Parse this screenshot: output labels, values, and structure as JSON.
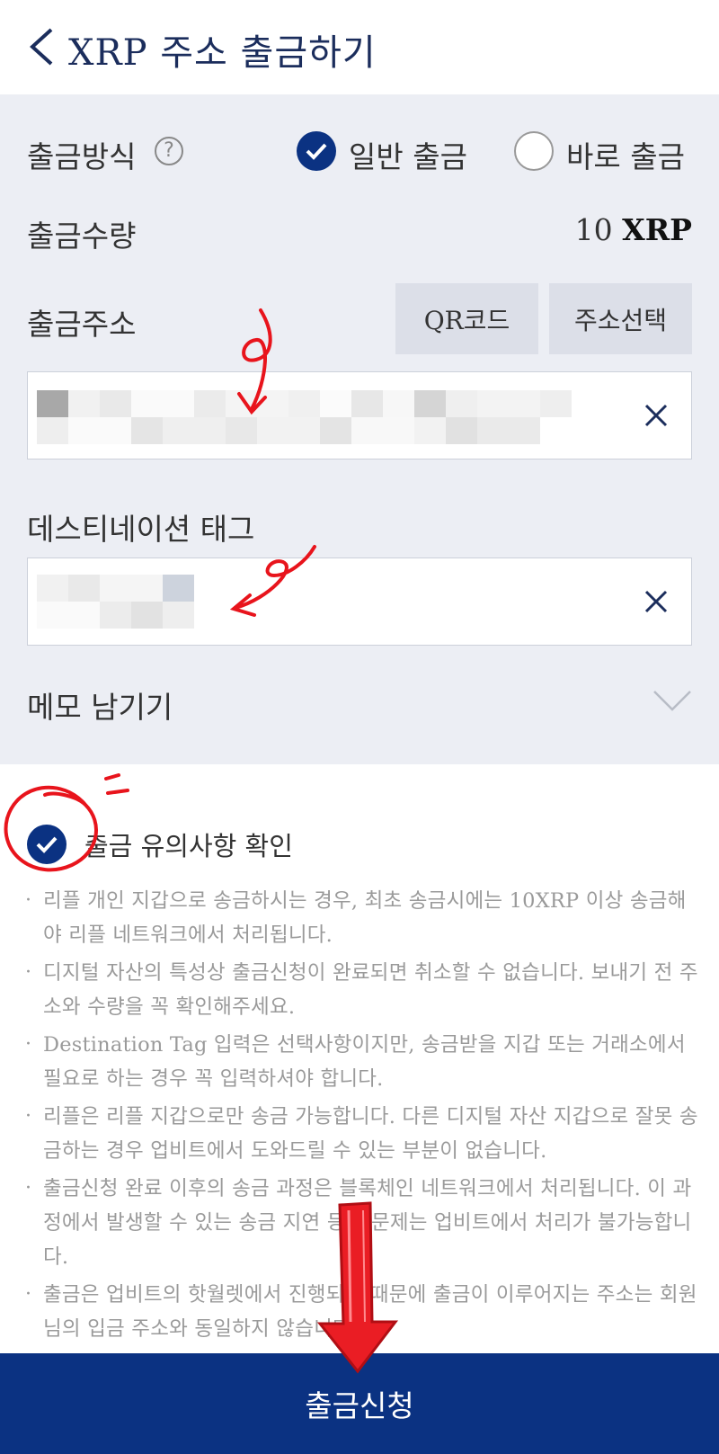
{
  "header": {
    "title": "XRP 주소 출금하기"
  },
  "form": {
    "method_label": "출금방식",
    "help_symbol": "?",
    "method_options": [
      {
        "label": "일반 출금",
        "selected": true
      },
      {
        "label": "바로 출금",
        "selected": false
      }
    ],
    "amount_label": "출금수량",
    "amount_value": "10",
    "amount_unit": "XRP",
    "address_label": "출금주소",
    "qr_button": "QR코드",
    "address_select_button": "주소선택",
    "destination_tag_label": "데스티네이션 태그",
    "memo_label": "메모 남기기"
  },
  "notice": {
    "checked": true,
    "title": "출금 유의사항 확인",
    "items": [
      "리플 개인 지갑으로 송금하시는 경우, 최초 송금시에는 10XRP 이상 송금해야 리플 네트워크에서 처리됩니다.",
      "디지털 자산의 특성상 출금신청이 완료되면 취소할 수 없습니다. 보내기 전 주소와 수량을 꼭 확인해주세요.",
      "Destination Tag 입력은 선택사항이지만, 송금받을 지갑 또는 거래소에서 필요로 하는 경우 꼭 입력하셔야 합니다.",
      "리플은 리플 지갑으로만 송금 가능합니다. 다른 디지털 자산 지갑으로 잘못 송금하는 경우 업비트에서 도와드릴 수 있는 부분이 없습니다.",
      "출금신청 완료 이후의 송금 과정은 블록체인 네트워크에서 처리됩니다. 이 과정에서 발생할 수 있는 송금 지연 등의 문제는 업비트에서 처리가 불가능합니다.",
      "출금은 업비트의 핫월렛에서 진행되기 때문에 출금이 이루어지는 주소는 회원님의 입금 주소와 동일하지 않습니다."
    ]
  },
  "submit": {
    "label": "출금신청"
  },
  "colors": {
    "brand": "#0b3282",
    "form_bg": "#eceef4",
    "annotation": "#e8141c"
  },
  "icons": [
    "back-chevron-icon",
    "help-icon",
    "check-icon",
    "clear-icon",
    "chevron-down-icon"
  ]
}
